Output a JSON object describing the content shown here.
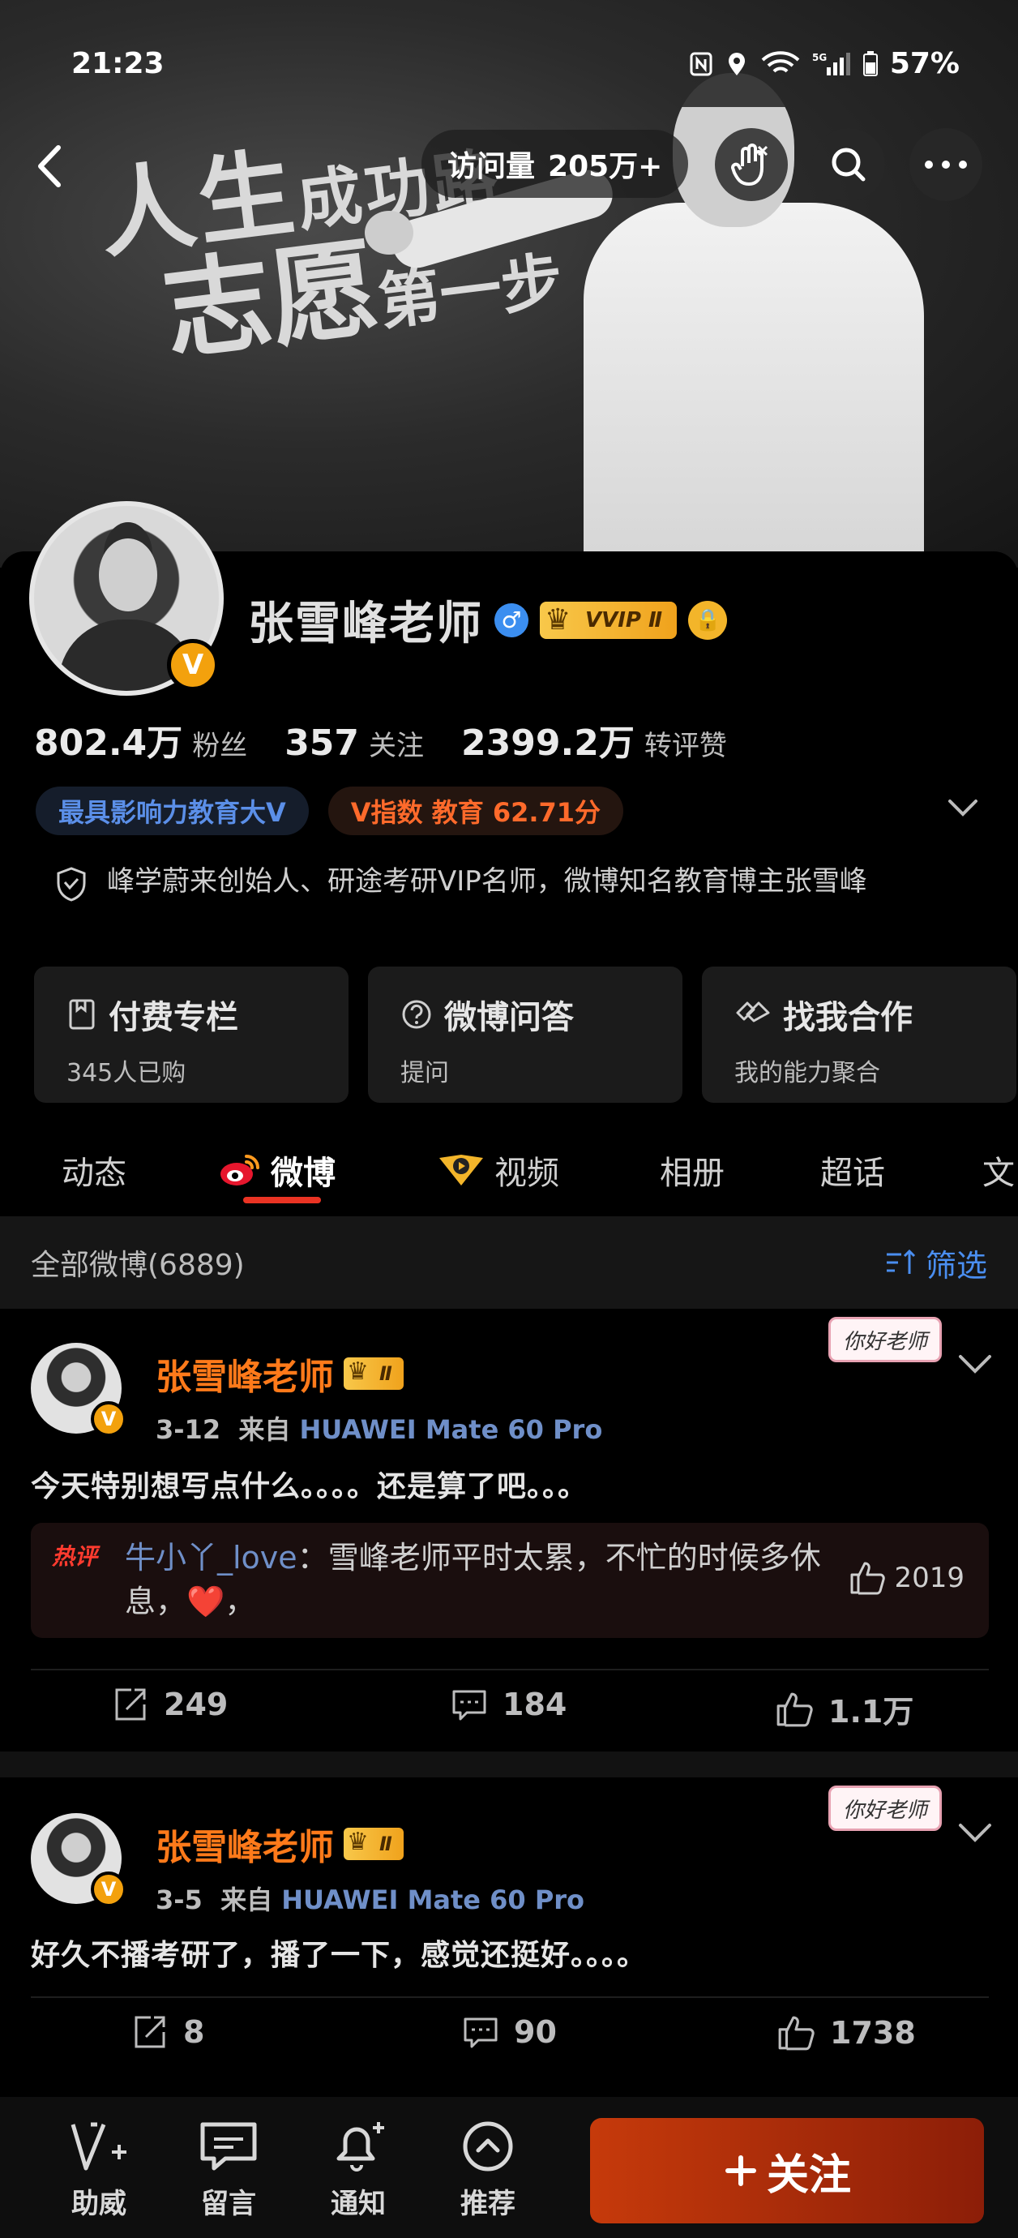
{
  "status_bar": {
    "time": "21:23",
    "battery": "57%",
    "network": "5G"
  },
  "cover": {
    "chalk_line1": "人生",
    "chalk_line1_small": "成功路",
    "chalk_line2": "志愿",
    "chalk_line2_small": "第一步"
  },
  "header": {
    "visits_label": "访问量",
    "visits_value": "205万+"
  },
  "profile": {
    "name": "张雪峰老师",
    "gender": "♂",
    "vvip_label": "VVIP Ⅱ",
    "v_badge": "V",
    "stats": [
      {
        "value": "802.4万",
        "label": "粉丝"
      },
      {
        "value": "357",
        "label": "关注"
      },
      {
        "value": "2399.2万",
        "label": "转评赞"
      }
    ],
    "tags": [
      "最具影响力教育大V",
      "V指数  教育  62.71分"
    ],
    "intro": "峰学蔚来创始人、研途考研VIP名师，微博知名教育博主张雪峰"
  },
  "cards": [
    {
      "title": "付费专栏",
      "sub": "345人已购"
    },
    {
      "title": "微博问答",
      "sub": "提问"
    },
    {
      "title": "找我合作",
      "sub": "我的能力聚合"
    }
  ],
  "tabs": [
    "动态",
    "微博",
    "视频",
    "相册",
    "超话",
    "文"
  ],
  "filter_bar": {
    "count": "全部微博(6889)",
    "filter": "筛选"
  },
  "posts": [
    {
      "author": "张雪峰老师",
      "vip": "Ⅱ",
      "date": "3-12",
      "source_prefix": "来自",
      "device": "HUAWEI Mate 60 Pro",
      "sticker": "你好老师",
      "text": "今天特别想写点什么。。。。还是算了吧。。。",
      "hot_comment": {
        "hot_label": "热评",
        "user": "牛小丫_love",
        "text": "：雪峰老师平时太累，不忙的时候多休息，❤️，",
        "likes": "2019"
      },
      "reposts": "249",
      "comments": "184",
      "likes": "1.1万"
    },
    {
      "author": "张雪峰老师",
      "vip": "Ⅱ",
      "date": "3-5",
      "source_prefix": "来自",
      "device": "HUAWEI Mate 60 Pro",
      "sticker": "你好老师",
      "text": "好久不播考研了，播了一下，感觉还挺好。。。。",
      "reposts": "8",
      "comments": "90",
      "likes": "1738"
    }
  ],
  "bottom_bar": {
    "items": [
      {
        "label": "助威",
        "icon": "cheer-icon"
      },
      {
        "label": "留言",
        "icon": "message-icon"
      },
      {
        "label": "通知",
        "icon": "bell-icon"
      },
      {
        "label": "推荐",
        "icon": "up-circle-icon"
      }
    ],
    "follow": "关注"
  },
  "colors": {
    "accent_orange": "#ff7a1a",
    "link_blue": "#4a8ef0",
    "tab_red": "#ea3323"
  }
}
